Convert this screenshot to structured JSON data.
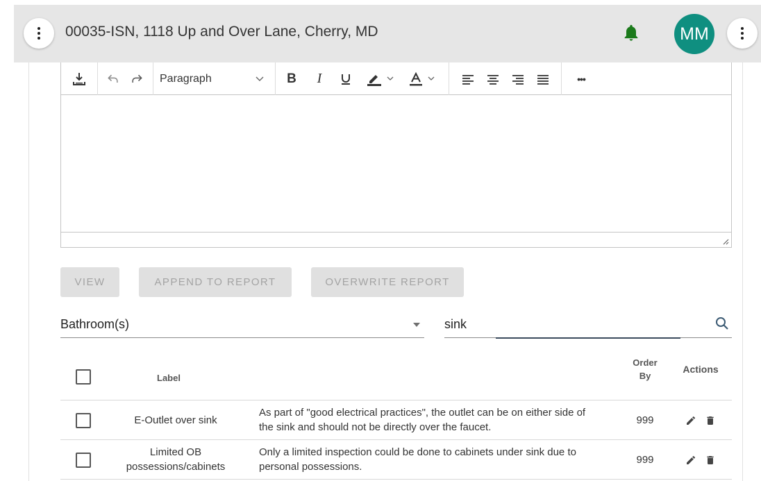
{
  "header": {
    "title": "00035-ISN, 1118 Up and Over Lane, Cherry, MD",
    "avatar_initials": "MM",
    "bell_color": "#1b7a1b",
    "avatar_color": "#0f8f80"
  },
  "editor": {
    "block_format": "Paragraph",
    "toolbar_icons": [
      "save-icon",
      "undo-icon",
      "redo-icon",
      "bold-icon",
      "italic-icon",
      "underline-icon",
      "highlight-icon",
      "font-color-icon",
      "align-left-icon",
      "align-center-icon",
      "align-right-icon",
      "justify-icon",
      "more-icon"
    ],
    "bold": "B",
    "italic": "I",
    "more": "•••"
  },
  "actions": {
    "view": "VIEW",
    "append": "APPEND TO REPORT",
    "overwrite": "OVERWRITE REPORT"
  },
  "filter": {
    "category": "Bathroom(s)",
    "search_value": "sink"
  },
  "table": {
    "headers": {
      "label": "Label",
      "order_by_1": "Order",
      "order_by_2": "By",
      "actions": "Actions"
    },
    "rows": [
      {
        "label": "E-Outlet over sink",
        "description_1": "As part of \"good electrical practices\", the outlet can be on either side of",
        "description_2": "the sink and should not be directly over the faucet.",
        "order_by": "999"
      },
      {
        "label_1": "Limited OB",
        "label_2": "possessions/cabinets",
        "description_1": "Only a limited inspection could be done to cabinets under sink due to",
        "description_2": "personal possessions.",
        "order_by": "999"
      }
    ]
  }
}
